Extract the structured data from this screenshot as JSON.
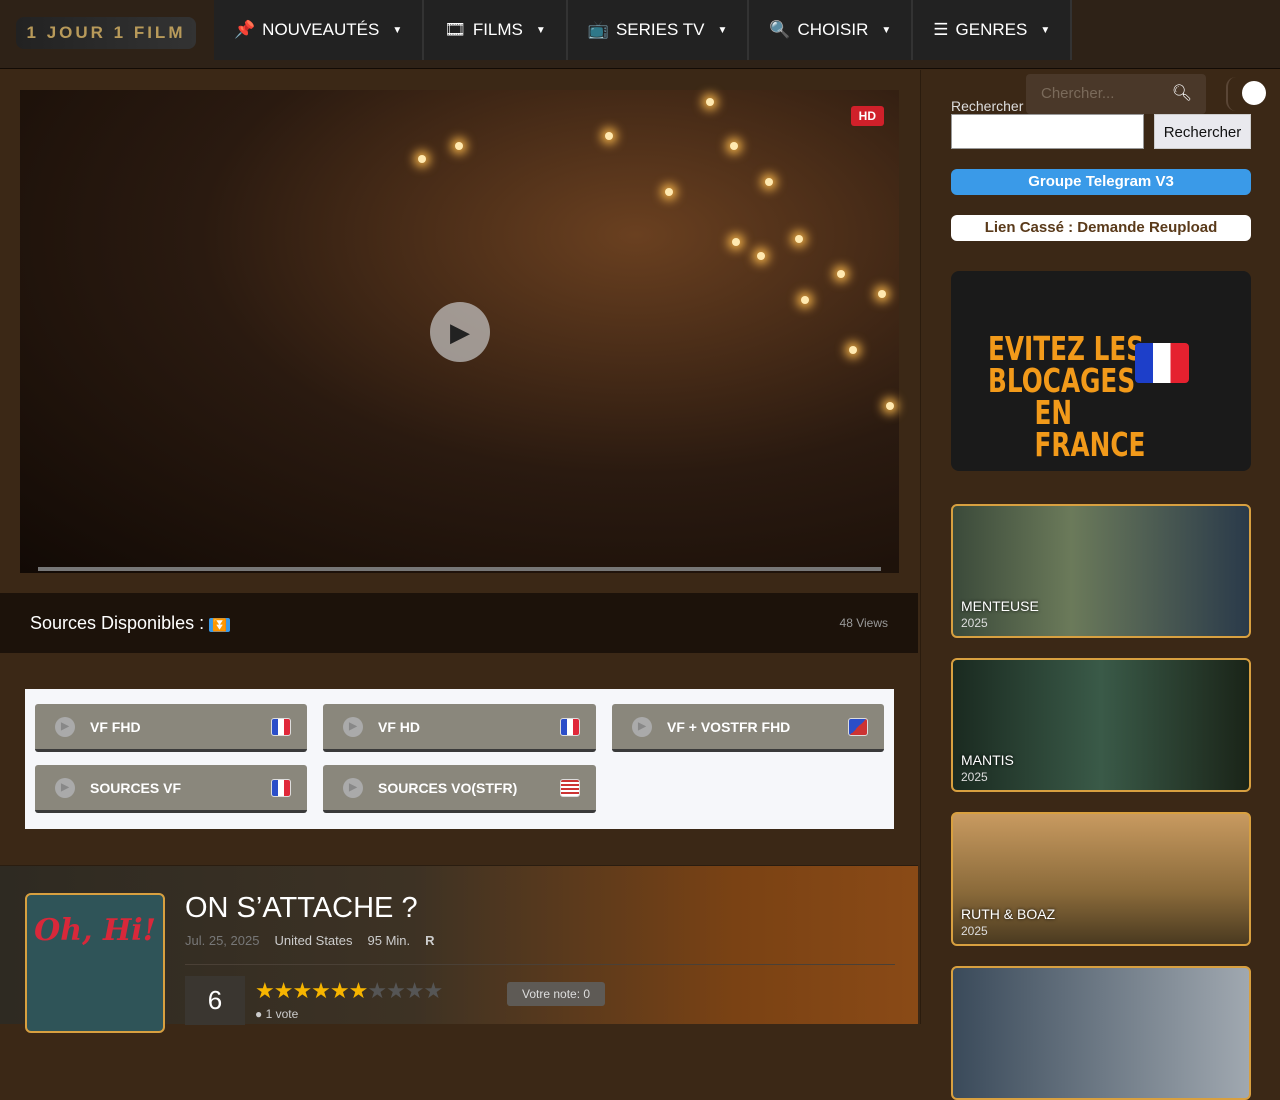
{
  "header": {
    "logo": "1 JOUR 1 FILM",
    "nav": [
      {
        "label": "NOUVEAUTÉS",
        "icon": "pin-icon"
      },
      {
        "label": "FILMS",
        "icon": "film-icon"
      },
      {
        "label": "SERIES TV",
        "icon": "tv-icon"
      },
      {
        "label": "CHOISIR",
        "icon": "search-icon"
      },
      {
        "label": "GENRES",
        "icon": "list-icon"
      }
    ]
  },
  "player": {
    "badge": "HD"
  },
  "sources": {
    "title": "Sources Disponibles :",
    "views": "48 Views",
    "buttons": [
      {
        "label": "VF FHD",
        "flag": "fr"
      },
      {
        "label": "VF HD",
        "flag": "fr"
      },
      {
        "label": "VF + VOSTFR FHD",
        "flag": "fr-uk"
      },
      {
        "label": "SOURCES VF",
        "flag": "fr"
      },
      {
        "label": "SOURCES VO(STFR)",
        "flag": "us"
      }
    ]
  },
  "movie": {
    "poster_title": "Oh, Hi!",
    "title": "ON S’ATTACHE ?",
    "date": "Jul. 25, 2025",
    "country": "United States",
    "duration": "95 Min.",
    "rating_code": "R",
    "score": "6",
    "stars": "6 of 10",
    "votes": "1 vote",
    "my_note": "Votre note: 0"
  },
  "sidebar": {
    "search_placeholder": "Chercher...",
    "search_label": "Rechercher",
    "search_button": "Rechercher",
    "telegram": "Groupe Telegram V3",
    "broken_link": "Lien Cassé : Demande Reupload",
    "ad_text": [
      "EVITEZ LES",
      "BLOCAGES",
      "EN FRANCE"
    ],
    "cards": [
      {
        "title": "MENTEUSE",
        "year": "2025"
      },
      {
        "title": "MANTIS",
        "year": "2025"
      },
      {
        "title": "RUTH & BOAZ",
        "year": "2025"
      }
    ]
  },
  "colors": {
    "accent": "#d8a040",
    "telegram": "#3a9ae8",
    "hd": "#d0202a",
    "star": "#f7b500"
  }
}
